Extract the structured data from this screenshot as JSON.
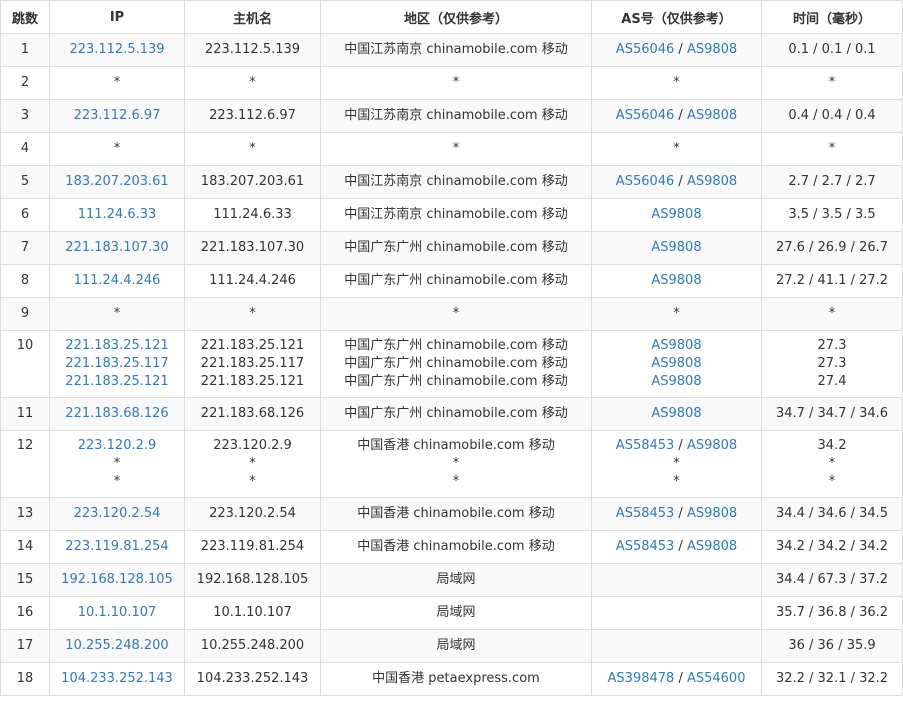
{
  "headers": [
    "跳数",
    "IP",
    "主机名",
    "地区（仅供参考）",
    "AS号（仅供参考）",
    "时间（毫秒）"
  ],
  "rows": [
    {
      "hop": "1",
      "entries": [
        {
          "ip": "223.112.5.139",
          "host": "223.112.5.139",
          "region": "中国江苏南京 chinamobile.com 移动",
          "as": [
            "AS56046",
            "AS9808"
          ]
        }
      ],
      "time": "0.1 / 0.1 / 0.1"
    },
    {
      "hop": "2",
      "entries": [
        {
          "ip": "*",
          "host": "*",
          "region": "*",
          "as": [
            "*"
          ]
        }
      ],
      "time": "*"
    },
    {
      "hop": "3",
      "entries": [
        {
          "ip": "223.112.6.97",
          "host": "223.112.6.97",
          "region": "中国江苏南京 chinamobile.com 移动",
          "as": [
            "AS56046",
            "AS9808"
          ]
        }
      ],
      "time": "0.4 / 0.4 / 0.4"
    },
    {
      "hop": "4",
      "entries": [
        {
          "ip": "*",
          "host": "*",
          "region": "*",
          "as": [
            "*"
          ]
        }
      ],
      "time": "*"
    },
    {
      "hop": "5",
      "entries": [
        {
          "ip": "183.207.203.61",
          "host": "183.207.203.61",
          "region": "中国江苏南京 chinamobile.com 移动",
          "as": [
            "AS56046",
            "AS9808"
          ]
        }
      ],
      "time": "2.7 / 2.7 / 2.7"
    },
    {
      "hop": "6",
      "entries": [
        {
          "ip": "111.24.6.33",
          "host": "111.24.6.33",
          "region": "中国江苏南京 chinamobile.com 移动",
          "as": [
            "AS9808"
          ]
        }
      ],
      "time": "3.5 / 3.5 / 3.5"
    },
    {
      "hop": "7",
      "entries": [
        {
          "ip": "221.183.107.30",
          "host": "221.183.107.30",
          "region": "中国广东广州 chinamobile.com 移动",
          "as": [
            "AS9808"
          ]
        }
      ],
      "time": "27.6 / 26.9 / 26.7"
    },
    {
      "hop": "8",
      "entries": [
        {
          "ip": "111.24.4.246",
          "host": "111.24.4.246",
          "region": "中国广东广州 chinamobile.com 移动",
          "as": [
            "AS9808"
          ]
        }
      ],
      "time": "27.2 / 41.1 / 27.2"
    },
    {
      "hop": "9",
      "entries": [
        {
          "ip": "*",
          "host": "*",
          "region": "*",
          "as": [
            "*"
          ]
        }
      ],
      "time": "*"
    },
    {
      "hop": "10",
      "entries": [
        {
          "ip": "221.183.25.121",
          "host": "221.183.25.121",
          "region": "中国广东广州 chinamobile.com 移动",
          "as": [
            "AS9808"
          ],
          "time": "27.3"
        },
        {
          "ip": "221.183.25.117",
          "host": "221.183.25.117",
          "region": "中国广东广州 chinamobile.com 移动",
          "as": [
            "AS9808"
          ],
          "time": "27.3"
        },
        {
          "ip": "221.183.25.121",
          "host": "221.183.25.121",
          "region": "中国广东广州 chinamobile.com 移动",
          "as": [
            "AS9808"
          ],
          "time": "27.4"
        }
      ]
    },
    {
      "hop": "11",
      "entries": [
        {
          "ip": "221.183.68.126",
          "host": "221.183.68.126",
          "region": "中国广东广州 chinamobile.com 移动",
          "as": [
            "AS9808"
          ]
        }
      ],
      "time": "34.7 / 34.7 / 34.6"
    },
    {
      "hop": "12",
      "entries": [
        {
          "ip": "223.120.2.9",
          "host": "223.120.2.9",
          "region": "中国香港 chinamobile.com 移动",
          "as": [
            "AS58453",
            "AS9808"
          ],
          "time": "34.2"
        },
        {
          "ip": "*",
          "host": "*",
          "region": "*",
          "as": [
            "*"
          ],
          "time": "*"
        },
        {
          "ip": "*",
          "host": "*",
          "region": "*",
          "as": [
            "*"
          ],
          "time": "*"
        }
      ]
    },
    {
      "hop": "13",
      "entries": [
        {
          "ip": "223.120.2.54",
          "host": "223.120.2.54",
          "region": "中国香港 chinamobile.com 移动",
          "as": [
            "AS58453",
            "AS9808"
          ]
        }
      ],
      "time": "34.4 / 34.6 / 34.5"
    },
    {
      "hop": "14",
      "entries": [
        {
          "ip": "223.119.81.254",
          "host": "223.119.81.254",
          "region": "中国香港 chinamobile.com 移动",
          "as": [
            "AS58453",
            "AS9808"
          ]
        }
      ],
      "time": "34.2 / 34.2 / 34.2"
    },
    {
      "hop": "15",
      "entries": [
        {
          "ip": "192.168.128.105",
          "host": "192.168.128.105",
          "region": "局域网",
          "as": []
        }
      ],
      "time": "34.4 / 67.3 / 37.2"
    },
    {
      "hop": "16",
      "entries": [
        {
          "ip": "10.1.10.107",
          "host": "10.1.10.107",
          "region": "局域网",
          "as": []
        }
      ],
      "time": "35.7 / 36.8 / 36.2"
    },
    {
      "hop": "17",
      "entries": [
        {
          "ip": "10.255.248.200",
          "host": "10.255.248.200",
          "region": "局域网",
          "as": []
        }
      ],
      "time": "36 / 36 / 35.9"
    },
    {
      "hop": "18",
      "entries": [
        {
          "ip": "104.233.252.143",
          "host": "104.233.252.143",
          "region": "中国香港 petaexpress.com",
          "as": [
            "AS398478",
            "AS54600"
          ]
        }
      ],
      "time": "32.2 / 32.1 / 32.2"
    }
  ],
  "colors": {
    "link": "#337ab7",
    "text": "#333333",
    "border": "#dddddd",
    "stripe": "#f9f9f9"
  }
}
